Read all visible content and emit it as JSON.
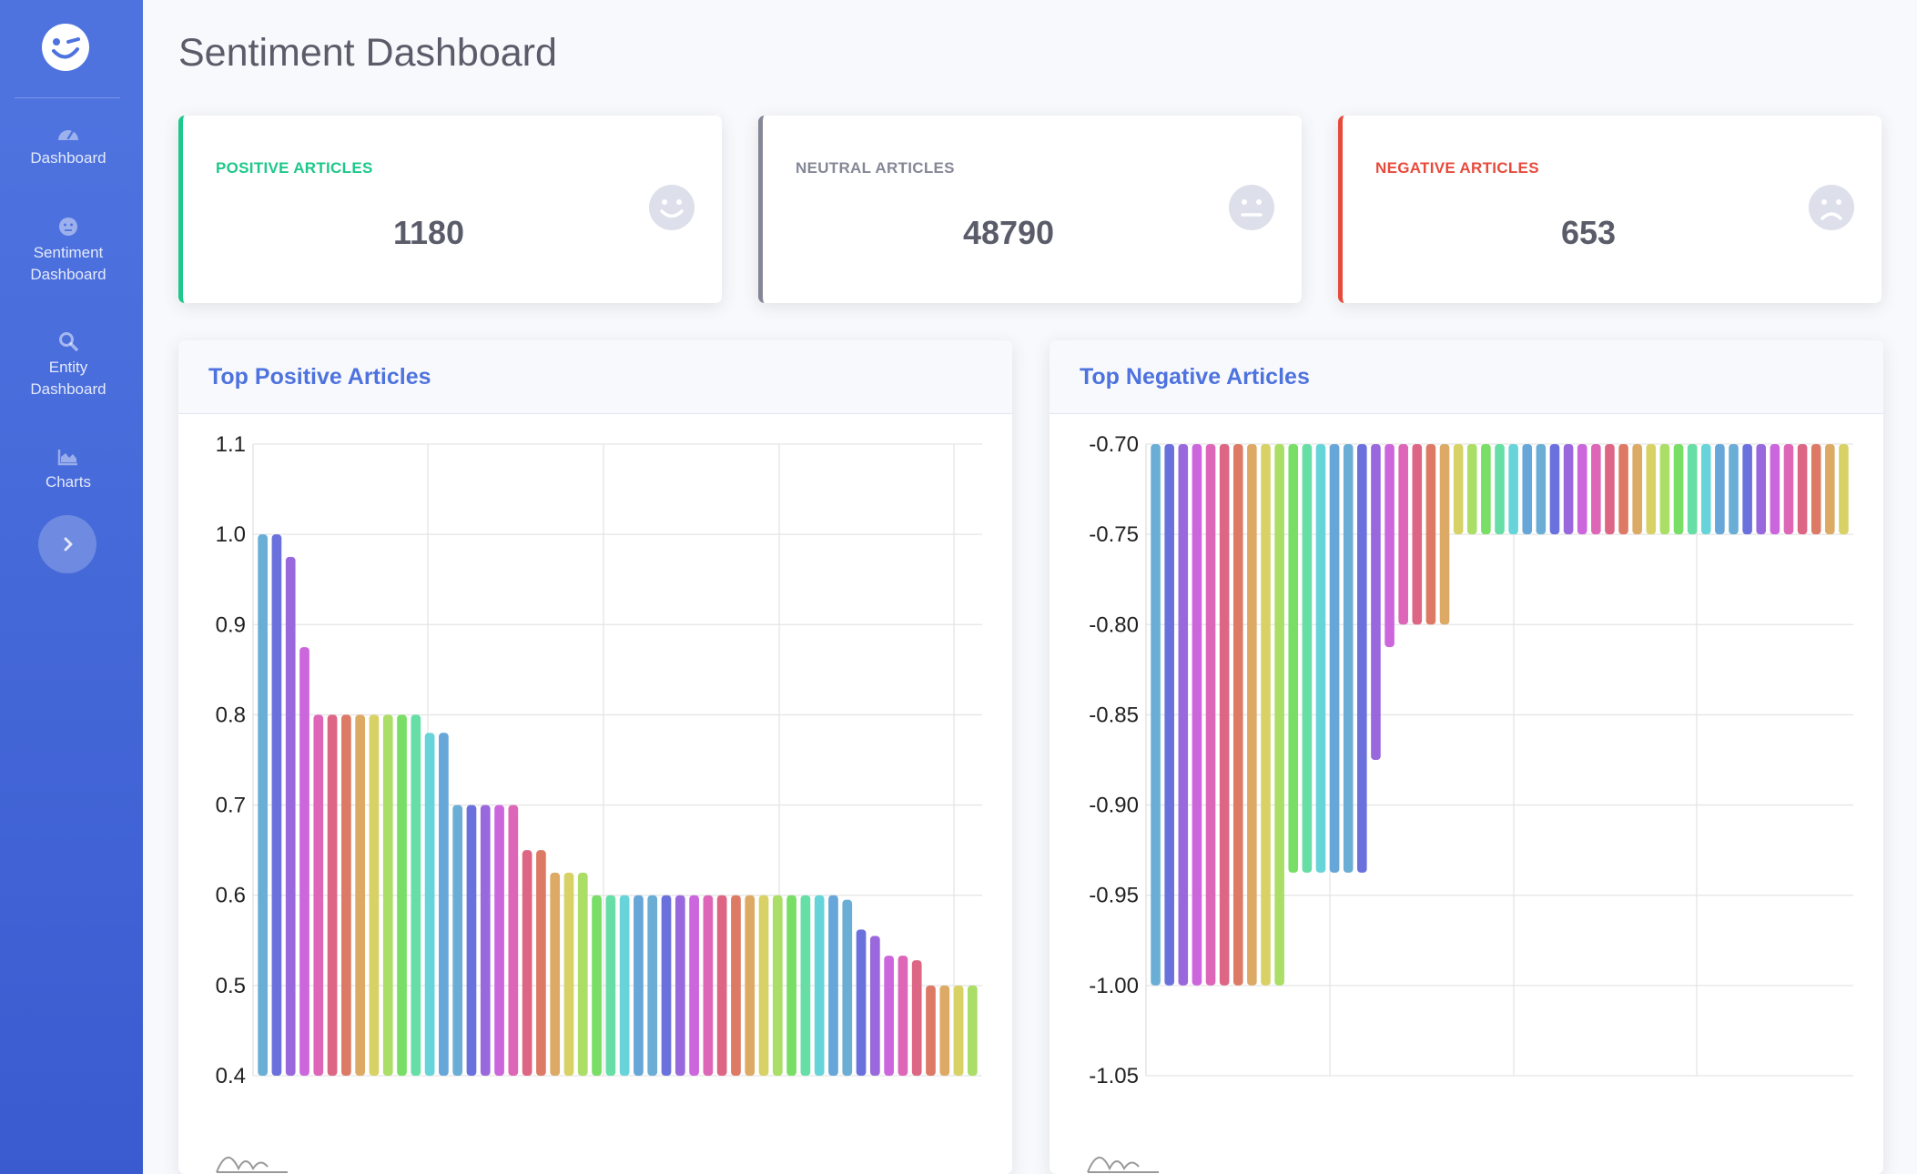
{
  "app": {
    "title": "Sentiment Dashboard"
  },
  "sidebar": {
    "logo_icon": "winking-face-icon",
    "items": [
      {
        "label": "Dashboard",
        "icon": "tachometer-icon"
      },
      {
        "label": "Sentiment\nDashboard",
        "icon": "neutral-face-icon"
      },
      {
        "label": "Entity\nDashboard",
        "icon": "search-icon"
      },
      {
        "label": "Charts",
        "icon": "area-chart-icon"
      }
    ],
    "toggle_icon": "chevron-right-icon"
  },
  "cards": [
    {
      "label": "POSITIVE ARTICLES",
      "value": "1180",
      "color": "#1cc88a",
      "icon": "smile-face-icon"
    },
    {
      "label": "NEUTRAL ARTICLES",
      "value": "48790",
      "color": "#858796",
      "icon": "neutral-face-icon"
    },
    {
      "label": "NEGATIVE ARTICLES",
      "value": "653",
      "color": "#e74a3b",
      "icon": "frown-face-icon"
    }
  ],
  "panels": [
    {
      "title": "Top Positive Articles"
    },
    {
      "title": "Top Negative Articles"
    }
  ],
  "colors": {
    "primary": "#4e73df",
    "text": "#5a5c69",
    "grid": "#e5e5e5"
  },
  "chart_data": [
    {
      "type": "bar",
      "title": "Top Positive Articles",
      "ylim": [
        0.4,
        1.1
      ],
      "yticks": [
        "1.1",
        "1.0",
        "0.9",
        "0.8",
        "0.7",
        "0.6",
        "0.5",
        "0.4"
      ],
      "grid": true,
      "values": [
        1.0,
        1.0,
        0.975,
        0.875,
        0.8,
        0.8,
        0.8,
        0.8,
        0.8,
        0.8,
        0.8,
        0.8,
        0.78,
        0.78,
        0.7,
        0.7,
        0.7,
        0.7,
        0.7,
        0.65,
        0.65,
        0.625,
        0.625,
        0.625,
        0.6,
        0.6,
        0.6,
        0.6,
        0.6,
        0.6,
        0.6,
        0.6,
        0.6,
        0.6,
        0.6,
        0.6,
        0.6,
        0.6,
        0.6,
        0.6,
        0.6,
        0.6,
        0.595,
        0.562,
        0.555,
        0.533,
        0.533,
        0.528,
        0.5,
        0.5,
        0.5,
        0.5
      ]
    },
    {
      "type": "bar",
      "title": "Top Negative Articles",
      "ylim": [
        -1.05,
        -0.7
      ],
      "yticks": [
        "-0.70",
        "-0.75",
        "-0.80",
        "-0.85",
        "-0.90",
        "-0.95",
        "-1.00",
        "-1.05"
      ],
      "grid": true,
      "values": [
        -1.0,
        -1.0,
        -1.0,
        -1.0,
        -1.0,
        -1.0,
        -1.0,
        -1.0,
        -1.0,
        -1.0,
        -0.9375,
        -0.9375,
        -0.9375,
        -0.9375,
        -0.9375,
        -0.9375,
        -0.875,
        -0.8125,
        -0.8,
        -0.8,
        -0.8,
        -0.8,
        -0.75,
        -0.75,
        -0.75,
        -0.75,
        -0.75,
        -0.75,
        -0.75,
        -0.75,
        -0.75,
        -0.75,
        -0.75,
        -0.75,
        -0.75,
        -0.75,
        -0.75,
        -0.75,
        -0.75,
        -0.75,
        -0.75,
        -0.75,
        -0.75,
        -0.75,
        -0.75,
        -0.75,
        -0.75,
        -0.75,
        -0.75,
        -0.75,
        -0.75
      ]
    }
  ]
}
